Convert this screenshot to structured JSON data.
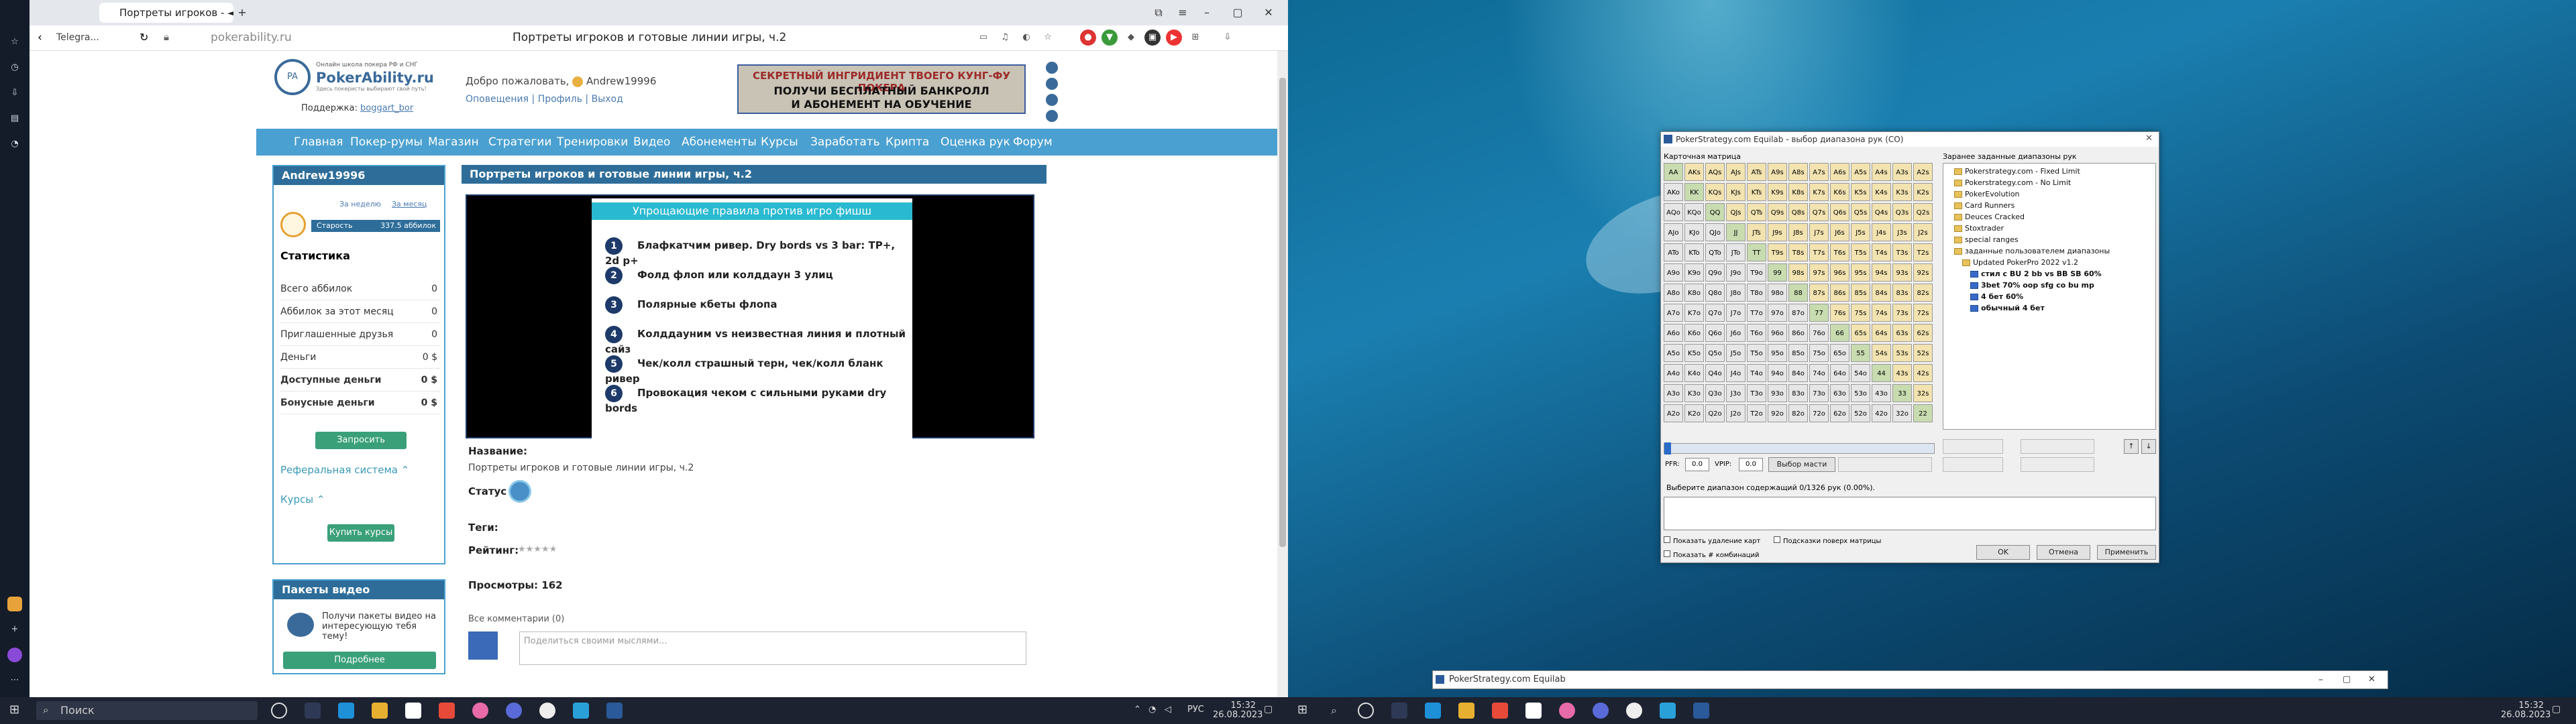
{
  "browser": {
    "tabs": [
      {
        "label": "Telegra..."
      },
      {
        "label": "Портреты игроков - ◄"
      }
    ],
    "url": "pokerability.ru",
    "page_title": "Портреты игроков и готовые линии игры, ч.2"
  },
  "site": {
    "logo_tag": "Онлайн школа покера РФ и СНГ",
    "logo_name": "PokerAbility.ru",
    "logo_sub": "Здесь покеристы выбирают свой путь!",
    "support_label": "Поддержка:",
    "support_link": "boggart_bor",
    "welcome": "Добро пожаловать,",
    "username": "Andrew19996",
    "user_links": [
      "Оповещения",
      "Профиль",
      "Выход"
    ],
    "banner": {
      "line1": "СЕКРЕТНЫЙ ИНГРИДИЕНТ ТВОЕГО КУНГ-ФУ ПОКЕРА",
      "line2": "ПОЛУЧИ БЕСПЛАТНЫЙ БАНКРОЛЛ",
      "line3": "И АБОНЕМЕНТ НА ОБУЧЕНИЕ"
    },
    "nav": [
      "Главная",
      "Покер-румы",
      "Магазин",
      "Стратегии",
      "Тренировки",
      "Видео",
      "Абонементы",
      "Курсы",
      "Заработать",
      "Крипта",
      "Оценка рук",
      "Форум"
    ]
  },
  "userpanel": {
    "title": "Andrew19996",
    "period_week": "За неделю",
    "period_month": "За месяц",
    "rank": "Старость",
    "rank_points": "337.5 аббилок",
    "stats_title": "Статистика",
    "rows": [
      {
        "label": "Всего аббилок",
        "value": "0"
      },
      {
        "label": "Аббилок за этот месяц",
        "value": "0"
      },
      {
        "label": "Приглашенные друзья",
        "value": "0"
      },
      {
        "label": "Деньги",
        "value": "0 $"
      },
      {
        "label": "Доступные деньги",
        "value": "0 $"
      },
      {
        "label": "Бонусные деньги",
        "value": "0 $"
      }
    ],
    "request_btn": "Запросить средства",
    "referral": "Реферальная система ⌃",
    "courses": "Курсы ⌃",
    "buy_courses_btn": "Купить курсы"
  },
  "videopanel": {
    "title": "Пакеты видео",
    "text": "Получи пакеты видео на интересующую тебя тему!",
    "btn": "Подробнее"
  },
  "main": {
    "title": "Портреты игроков и готовые линии игры, ч.2",
    "slide_title": "Упрощающие правила против игро фишш",
    "slide_items": [
      {
        "num": "1",
        "text": "Блафкатчим ривер. Dry bords vs 3 bar: TP+, 2d p+"
      },
      {
        "num": "2",
        "text": "Фолд флоп или колддаун 3 улиц"
      },
      {
        "num": "3",
        "text": "Полярные кбеты флопа"
      },
      {
        "num": "4",
        "text": "Колддауним vs неизвестная линия и плотный сайз"
      },
      {
        "num": "5",
        "text": "Чек/колл страшный терн, чек/колл бланк ривер"
      },
      {
        "num": "6",
        "text": "Провокация чеком с сильными руками dry bords"
      }
    ],
    "name_label": "Название:",
    "name_value": "Портреты игроков и готовые линии игры, ч.2",
    "status_label": "Статус :",
    "tags_label": "Теги:",
    "rating_label": "Рейтинг:",
    "rating_stars": "★★★★★",
    "views_label": "Просмотры: 162",
    "comments_label": "Все комментарии (0)",
    "comment_placeholder": "Поделиться своими мыслями..."
  },
  "taskbar_left": {
    "search": "Поиск",
    "time": "15:32",
    "date": "26.08.2023",
    "lang": "РУС"
  },
  "equilab": {
    "title": "PokerStrategy.com Equilab - выбор диапазона рук (CO)",
    "matrix_label": "Карточная матрица",
    "ranges_label": "Заранее заданные диапазоны рук",
    "ranks": [
      "A",
      "K",
      "Q",
      "J",
      "T",
      "9",
      "8",
      "7",
      "6",
      "5",
      "4",
      "3",
      "2"
    ],
    "tree": [
      {
        "text": "Pokerstrategy.com - Fixed Limit",
        "indent": 1
      },
      {
        "text": "Pokerstrategy.com - No Limit",
        "indent": 1
      },
      {
        "text": "PokerEvolution",
        "indent": 1
      },
      {
        "text": "Card Runners",
        "indent": 1
      },
      {
        "text": "Deuces Cracked",
        "indent": 1
      },
      {
        "text": "Stoxtrader",
        "indent": 1
      },
      {
        "text": "special ranges",
        "indent": 1
      },
      {
        "text": "заданные пользователем диапазоны",
        "indent": 1
      },
      {
        "text": "Updated PokerPro 2022 v1.2",
        "indent": 2
      },
      {
        "text": "стил с BU 2 bb vs BB SB 60%",
        "indent": 3
      },
      {
        "text": "3bet 70% oop sfg co bu mp",
        "indent": 3
      },
      {
        "text": "4 бет 60%",
        "indent": 3
      },
      {
        "text": "обычный 4 бет",
        "indent": 3
      }
    ],
    "pfr_label": "PFR:",
    "pfr_value": "0.0",
    "vpip_label": "VPIP:",
    "vpip_value": "0.0",
    "suit_btn": "Выбор масти",
    "select_text": "Выберите диапазон содержащий 0/1326 рук (0.00%).",
    "chk_remove": "Показать удаление карт",
    "chk_hints": "Подсказки поверх матрицы",
    "chk_combos": "Показать # комбинаций",
    "ok_btn": "OK",
    "cancel_btn": "Отмена",
    "apply_btn": "Применить",
    "mini_title": "PokerStrategy.com Equilab"
  },
  "taskbar_right": {
    "time": "15:32",
    "date": "26.08.2023"
  }
}
